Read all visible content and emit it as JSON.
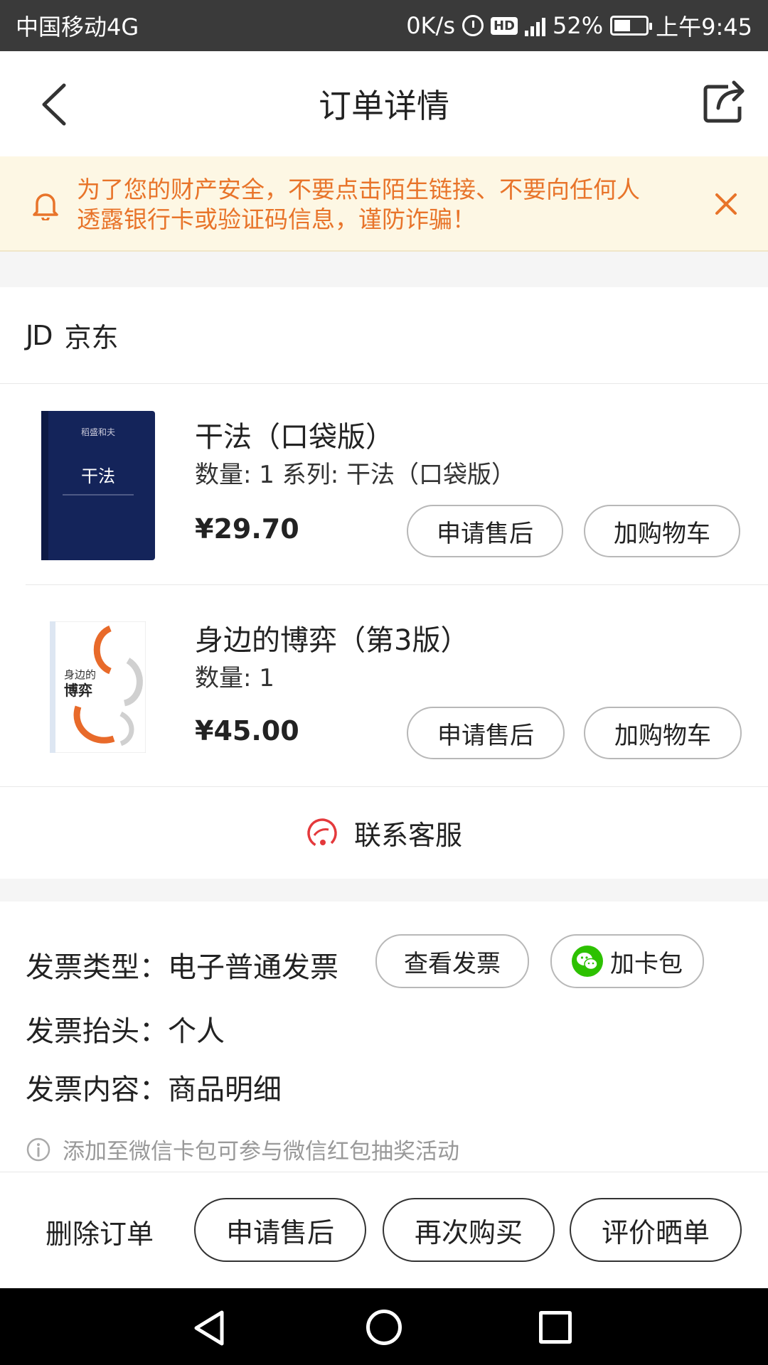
{
  "status_bar": {
    "carrier": "中国移动4G",
    "speed": "0K/s",
    "hd_label": "HD",
    "battery_pct": "52%",
    "battery_level": 0.52,
    "time": "上午9:45"
  },
  "header": {
    "title": "订单详情"
  },
  "notice": {
    "line1": "为了您的财产安全，不要点击陌生链接、不要向任何人",
    "line2": "透露银行卡或验证码信息，谨防诈骗！"
  },
  "shop": {
    "logo": "JD",
    "name": "京东"
  },
  "products": [
    {
      "title": "干法（口袋版）",
      "meta": "数量: 1 系列: 干法（口袋版）",
      "price": "¥29.70",
      "after_sale_label": "申请售后",
      "cart_label": "加购物车",
      "cover_title": "干法",
      "cover_top": "稻盛和夫"
    },
    {
      "title": "身边的博弈（第3版）",
      "meta": "数量: 1",
      "price": "¥45.00",
      "after_sale_label": "申请售后",
      "cart_label": "加购物车",
      "cover_title_line1": "身边的",
      "cover_title_line2": "博弈"
    }
  ],
  "service": {
    "label": "联系客服"
  },
  "invoice": {
    "type_key": "发票类型：",
    "type_value": "电子普通发票",
    "view_label": "查看发票",
    "wallet_label": "加卡包",
    "title_key": "发票抬头：",
    "title_value": "个人",
    "content_key": "发票内容：",
    "content_value": "商品明细",
    "tip": "添加至微信卡包可参与微信红包抽奖活动"
  },
  "actions": {
    "delete": "删除订单",
    "after_sale": "申请售后",
    "rebuy": "再次购买",
    "review": "评价晒单"
  },
  "colors": {
    "notice_text": "#e8742a",
    "notice_bg": "#fdf7e4",
    "service_icon": "#e4393c",
    "wechat": "#2dc100"
  }
}
